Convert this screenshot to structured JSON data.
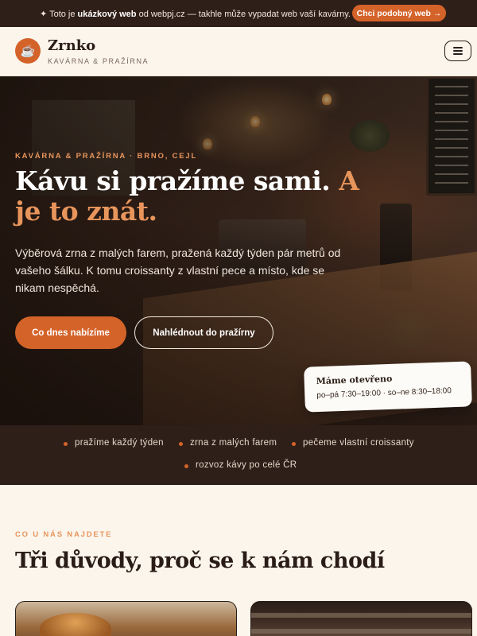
{
  "promo": {
    "prefix": "✦ Toto je ",
    "bold": "ukázkový web",
    "suffix": " od webpj.cz — takhle může vypadat web vaší kavárny.",
    "cta": "Chci podobný web →"
  },
  "header": {
    "logo_icon": "coffee-cup-icon",
    "brand": "Zrnko",
    "tagline": "KAVÁRNA & PRAŽÍRNA",
    "menu_icon": "hamburger-menu-icon"
  },
  "hero": {
    "eyebrow": "KAVÁRNA & PRAŽÍRNA · BRNO, CEJL",
    "headline_main": "Kávu si pražíme sami.",
    "headline_accent": "A je to znát.",
    "lead": "Výběrová zrna z malých farem, pražená každý týden pár metrů od vašeho šálku. K tomu croissanty z vlastní pece a místo, kde se nikam nespěchá.",
    "primary_button": "Co dnes nabízíme",
    "secondary_button": "Nahlédnout do pražírny",
    "hours_title": "Máme otevřeno",
    "hours_value": "po–pá 7:30–19:00 · so–ne 8:30–18:00"
  },
  "features": [
    "pražíme každý týden",
    "zrna z malých farem",
    "pečeme vlastní croissanty",
    "rozvoz kávy po celé ČR"
  ],
  "section": {
    "eyebrow": "CO U NÁS NAJDETE",
    "title": "Tři důvody, proč se k nám chodí"
  },
  "colors": {
    "accent": "#d4632a",
    "accent_light": "#e8955c",
    "dark": "#2f1f19",
    "cream": "#fbf5ec"
  }
}
